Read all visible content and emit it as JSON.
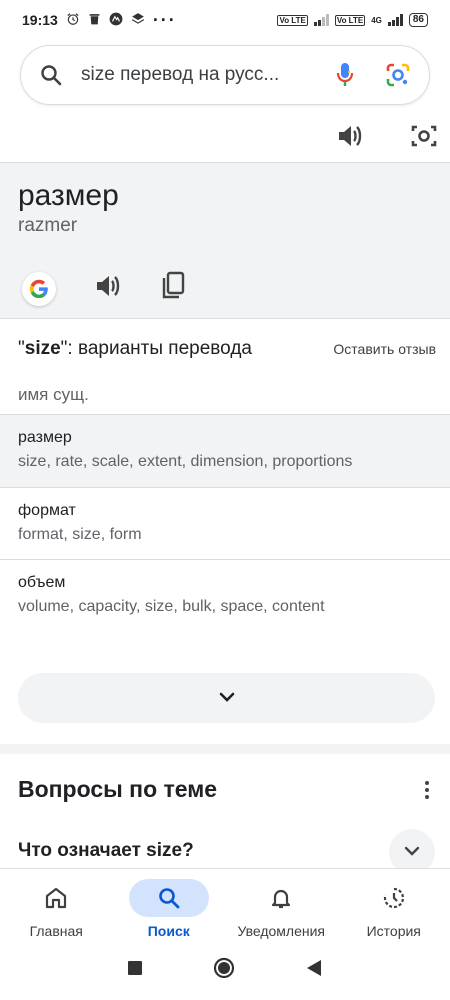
{
  "status_bar": {
    "time": "19:13",
    "battery": "86",
    "network": "4G",
    "volte": "Vo LTE"
  },
  "search": {
    "query": "size перевод на русс..."
  },
  "translation": {
    "word": "размер",
    "transliteration": "razmer"
  },
  "variants": {
    "title_quote_open": "\"",
    "title_term": "size",
    "title_rest": "\": варианты перевода",
    "feedback_label": "Оставить отзыв",
    "part_of_speech": "имя сущ.",
    "rows": [
      {
        "word": "размер",
        "synonyms": "size, rate, scale, extent, dimension, proportions"
      },
      {
        "word": "формат",
        "synonyms": "format, size, form"
      },
      {
        "word": "объем",
        "synonyms": "volume, capacity, size, bulk, space, content"
      }
    ]
  },
  "related": {
    "title": "Вопросы по теме",
    "question": "Что означает size?"
  },
  "bottom_nav": {
    "items": [
      {
        "label": "Главная",
        "icon": "home-icon"
      },
      {
        "label": "Поиск",
        "icon": "search-icon"
      },
      {
        "label": "Уведомления",
        "icon": "bell-icon"
      },
      {
        "label": "История",
        "icon": "history-icon"
      }
    ],
    "active": "Поиск"
  },
  "colors": {
    "accent": "#0b57d0",
    "active_pill": "#d3e3fd",
    "surface": "#f1f3f4"
  }
}
